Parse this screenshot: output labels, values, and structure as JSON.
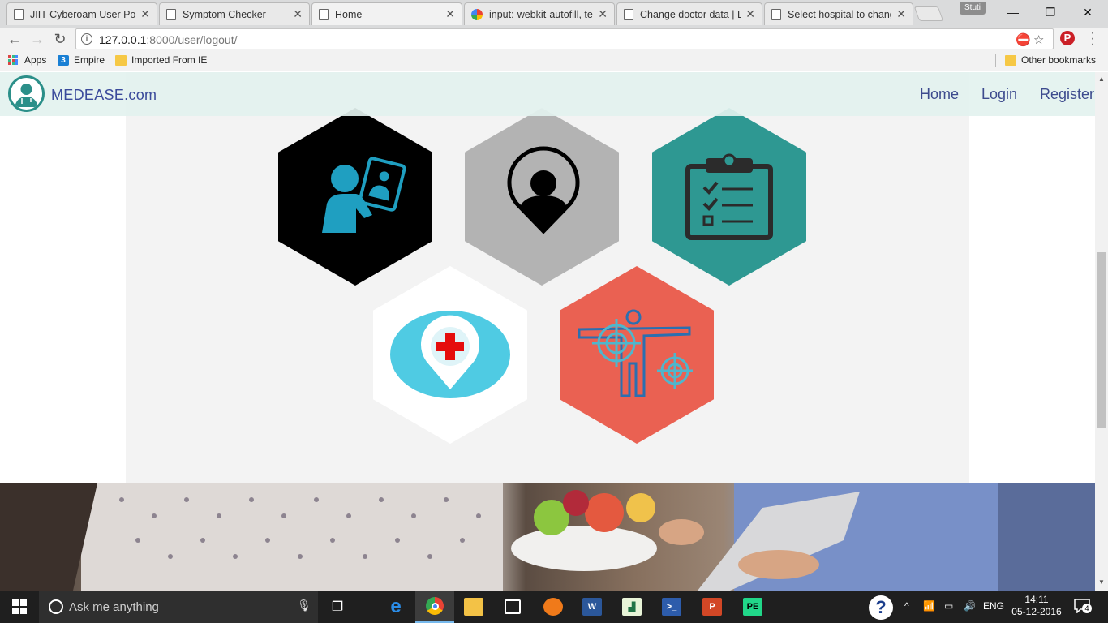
{
  "browser": {
    "tabs": [
      {
        "title": "JIIT Cyberoam User Port",
        "icon": "page-icon"
      },
      {
        "title": "Symptom Checker",
        "icon": "page-icon"
      },
      {
        "title": "Home",
        "icon": "page-icon",
        "active": true
      },
      {
        "title": "input:-webkit-autofill, te",
        "icon": "google-icon"
      },
      {
        "title": "Change doctor data | D",
        "icon": "page-icon"
      },
      {
        "title": "Select hospital to chang",
        "icon": "page-icon"
      }
    ],
    "profile_name": "Stuti",
    "url_host": "127.0.0.1",
    "url_rest": ":8000/user/logout/",
    "bookmarks": {
      "apps": "Apps",
      "empire": "Empire",
      "empire_badge": "3",
      "imported": "Imported From IE",
      "other": "Other bookmarks"
    }
  },
  "site": {
    "brand": "MEDEASE.com",
    "nav": {
      "home": "Home",
      "login": "Login",
      "register": "Register"
    },
    "features": [
      {
        "icon": "doctor-tablet-icon",
        "color": "#000000"
      },
      {
        "icon": "location-person-icon",
        "color": "#b3b3b3"
      },
      {
        "icon": "clipboard-checklist-icon",
        "color": "#2e9892"
      },
      {
        "icon": "hospital-location-icon",
        "color": "#ffffff"
      },
      {
        "icon": "body-target-icon",
        "color": "#ea6152"
      }
    ]
  },
  "taskbar": {
    "search_placeholder": "Ask me anything",
    "lang": "ENG",
    "time": "14:11",
    "date": "05-12-2016",
    "notifications": "4"
  }
}
